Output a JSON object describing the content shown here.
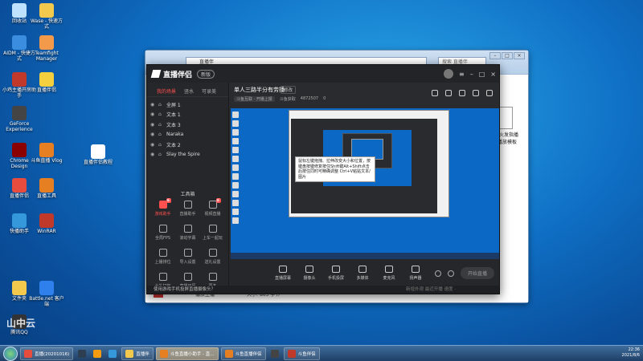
{
  "desktop_icons": [
    {
      "label": "回收站",
      "color": "#bfe3ff"
    },
    {
      "label": "Wase - 快速方式",
      "color": "#f2c94c"
    },
    {
      "label": "AIDM - 快捷方式",
      "color": "#3b8de0"
    },
    {
      "label": "Teamfight Manager",
      "color": "#f2994a"
    },
    {
      "label": "小鸡主播开房助手",
      "color": "#c0392b"
    },
    {
      "label": "直播伴侣",
      "color": "#f4d03f"
    },
    {
      "label": "GeForce Experience",
      "color": "#444444"
    },
    {
      "label": "Chrome Design",
      "color": "#8b0000"
    },
    {
      "label": "斗鱼直播 Vlog",
      "color": "#e67e22"
    },
    {
      "label": "直播伴侣教程",
      "color": "#ffffff"
    },
    {
      "label": "直播伴侣",
      "color": "#e74c3c"
    },
    {
      "label": "直播工具",
      "color": "#e67e22"
    },
    {
      "label": "快播助手",
      "color": "#3498db"
    },
    {
      "label": "WinRAR",
      "color": "#c0392b"
    },
    {
      "label": "文件夹",
      "color": "#f2c94c"
    },
    {
      "label": "Battle.net 客户端",
      "color": "#2f80ed"
    },
    {
      "label": "腾讯QQ",
      "color": "#333333"
    }
  ],
  "explorer": {
    "address": "直播伴",
    "search": "搜索 直播伴",
    "file_label": "一些火发指播录 播放模板",
    "bottom_left": "播放主播",
    "bottom_mid": "大小: 863 字节"
  },
  "app": {
    "name": "直播伴侣",
    "version_badge": "新版",
    "left_tabs": [
      "我的场景",
      "竖水",
      "可录美"
    ],
    "scenes": [
      "全屏 1",
      "文本 1",
      "文本 3",
      "Naraka",
      "文本 2",
      "Slay the Spire"
    ],
    "tools_title": "工具箱",
    "tools": [
      {
        "label": "游戏助手",
        "badge": "新",
        "active": true
      },
      {
        "label": "直播助手",
        "badge": "",
        "active": false
      },
      {
        "label": "视频直播",
        "badge": "新",
        "active": false
      },
      {
        "label": "全局FPS",
        "badge": "",
        "active": false
      },
      {
        "label": "滚动字幕",
        "badge": "",
        "active": false
      },
      {
        "label": "上车一起玩",
        "badge": "",
        "active": false
      },
      {
        "label": "上播排位",
        "badge": "",
        "active": false
      },
      {
        "label": "导入设置",
        "badge": "",
        "active": false
      },
      {
        "label": "送礼设置",
        "badge": "",
        "active": false
      },
      {
        "label": "大礼打包",
        "badge": "",
        "active": false
      },
      {
        "label": "直播日历",
        "badge": "",
        "active": false
      },
      {
        "label": "更多",
        "badge": "",
        "active": false
      }
    ],
    "stream_title": "单人三路半分有劳播",
    "stream_tag": "修改",
    "sub_items": [
      "斗鱼互联 · 开播上报",
      "斗鱼获取",
      "4872507",
      "0"
    ],
    "tooltip": "鼠标左键拖拽、拉伸改变大小和位置，按键盘按键修复按住Shift键Alt+Shift点击后按住同时可精确调整 Ctrl+V粘贴文本/图片",
    "controls": [
      "直播屏幕",
      "摄像头",
      "手机投屏",
      "多媒体",
      "麦克风",
      "扬声器"
    ],
    "start_label": "开始直播",
    "footer_text": "使用游戏手机投屏直播摄像头？",
    "footer_ticker": "新增外观     最近开播    速度  ·"
  },
  "taskbar": {
    "items": [
      {
        "label": "直播(20201016)",
        "color": "#e74c3c",
        "active": false
      },
      {
        "label": "",
        "color": "#2c3e50",
        "active": false
      },
      {
        "label": "",
        "color": "#f39c12",
        "active": false
      },
      {
        "label": "",
        "color": "#3498db",
        "active": false
      },
      {
        "label": "直播伴",
        "color": "#f2c94c",
        "active": false
      },
      {
        "label": "斗鱼直播小助手 - 直...",
        "color": "#e67e22",
        "active": true
      },
      {
        "label": "斗鱼直播伴侣",
        "color": "#e67e22",
        "active": false
      },
      {
        "label": "",
        "color": "#444444",
        "active": false
      },
      {
        "label": "斗鱼伴侣",
        "color": "#c0392b",
        "active": false
      }
    ],
    "time": "22:36",
    "date": "2021/8/6"
  },
  "watermark": "山中云"
}
